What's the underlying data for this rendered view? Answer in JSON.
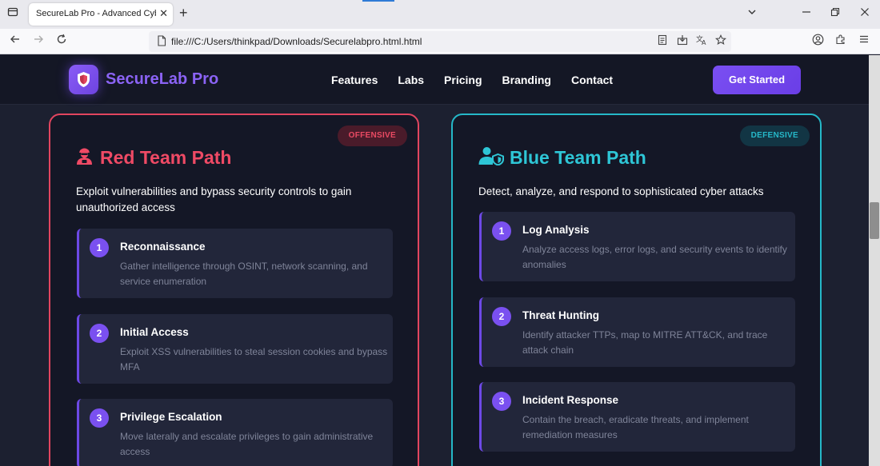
{
  "browser": {
    "tab_title": "SecureLab Pro - Advanced Cyber Ra",
    "url": "file:///C:/Users/thinkpad/Downloads/Securelabpro.html.html"
  },
  "header": {
    "brand": "SecureLab Pro",
    "nav": [
      "Features",
      "Labs",
      "Pricing",
      "Branding",
      "Contact"
    ],
    "cta": "Get Started"
  },
  "red": {
    "badge": "OFFENSIVE",
    "title": "Red Team Path",
    "description": "Exploit vulnerabilities and bypass security controls to gain unauthorized access",
    "steps": [
      {
        "num": "1",
        "title": "Reconnaissance",
        "desc": "Gather intelligence through OSINT, network scanning, and service enumeration"
      },
      {
        "num": "2",
        "title": "Initial Access",
        "desc": "Exploit XSS vulnerabilities to steal session cookies and bypass MFA"
      },
      {
        "num": "3",
        "title": "Privilege Escalation",
        "desc": "Move laterally and escalate privileges to gain administrative access"
      }
    ]
  },
  "blue": {
    "badge": "DEFENSIVE",
    "title": "Blue Team Path",
    "description": "Detect, analyze, and respond to sophisticated cyber attacks",
    "steps": [
      {
        "num": "1",
        "title": "Log Analysis",
        "desc": "Analyze access logs, error logs, and security events to identify anomalies"
      },
      {
        "num": "2",
        "title": "Threat Hunting",
        "desc": "Identify attacker TTPs, map to MITRE ATT&CK, and trace attack chain"
      },
      {
        "num": "3",
        "title": "Incident Response",
        "desc": "Contain the breach, eradicate threats, and implement remediation measures"
      }
    ]
  },
  "colors": {
    "accent": "#7a50f0",
    "red_team": "#e2455f",
    "blue_team": "#25b8c8",
    "page_bg": "#1c2030"
  },
  "icons": {
    "logo": "shield-icon",
    "red_team": "hacker-icon",
    "blue_team": "user-shield-icon"
  }
}
